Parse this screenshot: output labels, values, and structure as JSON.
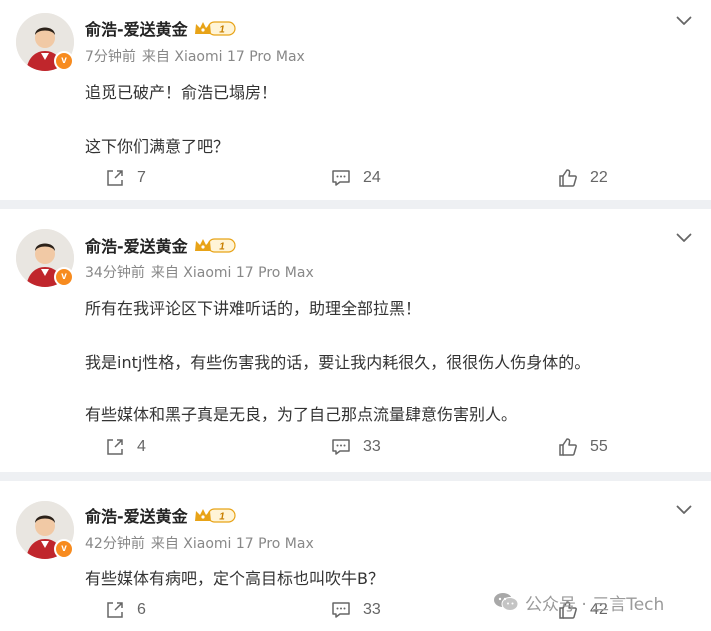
{
  "posts": [
    {
      "author": "俞浩-爱送黄金",
      "vip_level": "1",
      "time": "7分钟前",
      "source": "来自 Xiaomi 17 Pro Max",
      "lines": [
        "追觅已破产！俞浩已塌房！",
        "这下你们满意了吧？"
      ],
      "share_count": "7",
      "comment_count": "24",
      "like_count": "22"
    },
    {
      "author": "俞浩-爱送黄金",
      "vip_level": "1",
      "time": "34分钟前",
      "source": "来自 Xiaomi 17 Pro Max",
      "lines": [
        "所有在我评论区下讲难听话的，助理全部拉黑！",
        "我是intj性格，有些伤害我的话，要让我内耗很久，很很伤人伤身体的。",
        "有些媒体和黑子真是无良，为了自己那点流量肆意伤害别人。"
      ],
      "share_count": "4",
      "comment_count": "33",
      "like_count": "55"
    },
    {
      "author": "俞浩-爱送黄金",
      "vip_level": "1",
      "time": "42分钟前",
      "source": "来自 Xiaomi 17 Pro Max",
      "lines": [
        "有些媒体有病吧，定个高目标也叫吹牛B？"
      ],
      "share_count": "6",
      "comment_count": "33",
      "like_count": "42"
    }
  ],
  "watermark": {
    "text": "公众号 · 三言Tech"
  },
  "icons": {
    "verified": "verified-v-badge-icon",
    "vip": "crown-vip-icon",
    "more": "chevron-down-icon",
    "share": "share-icon",
    "comment": "comment-icon",
    "like": "thumbs-up-icon"
  },
  "colors": {
    "separator": "#eef0f3",
    "verified_badge": "#f78b1f",
    "vip_gold": "#e8a317",
    "meta_text": "#888888"
  }
}
